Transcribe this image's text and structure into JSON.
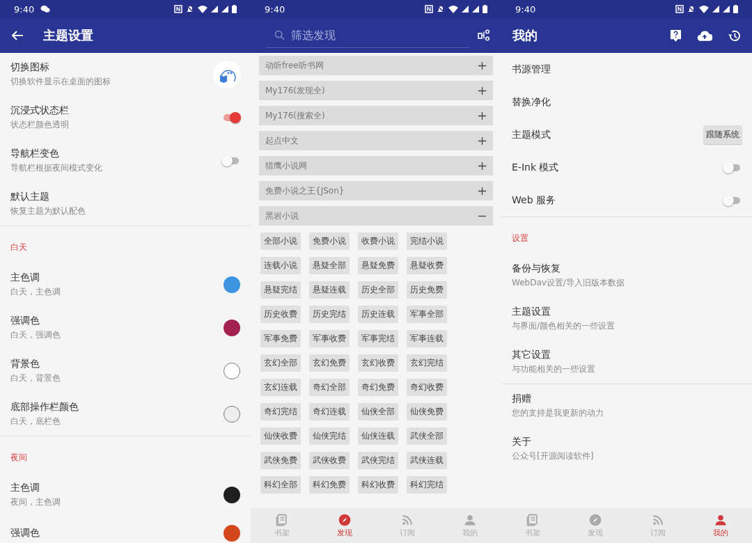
{
  "theme_settings": {
    "status_time": "9:40",
    "title": "主题设置",
    "sections": [
      {
        "items": [
          {
            "kind": "icon",
            "title": "切换图标",
            "subtitle": "切换软件显示在桌面的图标"
          },
          {
            "kind": "switch",
            "title": "沉浸式状态栏",
            "subtitle": "状态栏颜色透明",
            "on": true
          },
          {
            "kind": "switch",
            "title": "导航栏变色",
            "subtitle": "导航栏根据夜间模式变化",
            "on": false
          },
          {
            "kind": "plain",
            "title": "默认主题",
            "subtitle": "恢复主题为默认配色"
          }
        ]
      },
      {
        "header": "白天",
        "items": [
          {
            "kind": "color",
            "title": "主色调",
            "subtitle": "白天，主色调",
            "color": "#3d94e0"
          },
          {
            "kind": "color",
            "title": "强调色",
            "subtitle": "白天，强调色",
            "color": "#a3214f"
          },
          {
            "kind": "color",
            "title": "背景色",
            "subtitle": "白天，背景色",
            "color": "#ffffff"
          },
          {
            "kind": "color",
            "title": "底部操作栏颜色",
            "subtitle": "白天，底栏色",
            "color": "#eeeeee"
          }
        ]
      },
      {
        "header": "夜间",
        "items": [
          {
            "kind": "color",
            "title": "主色调",
            "subtitle": "夜间，主色调",
            "color": "#1f1f1f"
          },
          {
            "kind": "color",
            "title": "强调色",
            "color": "#d4461c"
          }
        ]
      }
    ]
  },
  "discover": {
    "status_time": "9:40",
    "search": {
      "placeholder": "筛选发现"
    },
    "sources": [
      {
        "name": "动听free听书网",
        "expanded": false
      },
      {
        "name": "My176(发现全)",
        "expanded": false
      },
      {
        "name": "My176(搜索全)",
        "expanded": false
      },
      {
        "name": "起点中文",
        "expanded": false
      },
      {
        "name": "猎鹰小说网",
        "expanded": false
      },
      {
        "name": "免费小说之王{JSon}",
        "expanded": false
      },
      {
        "name": "黑岩小说",
        "expanded": true,
        "tags": [
          "全部小说",
          "免费小说",
          "收费小说",
          "完结小说",
          "连载小说",
          "悬疑全部",
          "悬疑免费",
          "悬疑收费",
          "悬疑完结",
          "悬疑连载",
          "历史全部",
          "历史免费",
          "历史收费",
          "历史完结",
          "历史连载",
          "军事全部",
          "军事免费",
          "军事收费",
          "军事完结",
          "军事连载",
          "玄幻全部",
          "玄幻免费",
          "玄幻收费",
          "玄幻完结",
          "玄幻连载",
          "奇幻全部",
          "奇幻免费",
          "奇幻收费",
          "奇幻完结",
          "奇幻连载",
          "仙侠全部",
          "仙侠免费",
          "仙侠收费",
          "仙侠完结",
          "仙侠连载",
          "武侠全部",
          "武侠免费",
          "武侠收费",
          "武侠完结",
          "武侠连载",
          "科幻全部",
          "科幻免费",
          "科幻收费",
          "科幻完结"
        ]
      }
    ],
    "bottom_nav": [
      {
        "label": "书架",
        "selected": false
      },
      {
        "label": "发现",
        "selected": true
      },
      {
        "label": "订阅",
        "selected": false
      },
      {
        "label": "我的",
        "selected": false
      }
    ]
  },
  "mine": {
    "status_time": "9:40",
    "title": "我的",
    "sections": [
      {
        "items": [
          {
            "kind": "plain",
            "title": "书源管理"
          },
          {
            "kind": "plain",
            "title": "替换净化"
          },
          {
            "kind": "button",
            "title": "主题模式",
            "value": "跟随系统"
          },
          {
            "kind": "switch",
            "title": "E-Ink 模式",
            "on": false
          },
          {
            "kind": "switch",
            "title": "Web 服务",
            "on": false
          }
        ]
      },
      {
        "header": "设置",
        "items": [
          {
            "kind": "plain",
            "title": "备份与恢复",
            "subtitle": "WebDav设置/导入旧版本数据"
          },
          {
            "kind": "plain",
            "title": "主题设置",
            "subtitle": "与界面/颜色相关的一些设置"
          },
          {
            "kind": "plain",
            "title": "其它设置",
            "subtitle": "与功能相关的一些设置"
          }
        ]
      },
      {
        "items": [
          {
            "kind": "plain",
            "title": "捐赠",
            "subtitle": "您的支持是我更新的动力"
          },
          {
            "kind": "plain",
            "title": "关于",
            "subtitle": "公众号[开源阅读软件]"
          }
        ]
      }
    ],
    "bottom_nav": [
      {
        "label": "书架",
        "selected": false
      },
      {
        "label": "发现",
        "selected": false
      },
      {
        "label": "订阅",
        "selected": false
      },
      {
        "label": "我的",
        "selected": true
      }
    ]
  }
}
